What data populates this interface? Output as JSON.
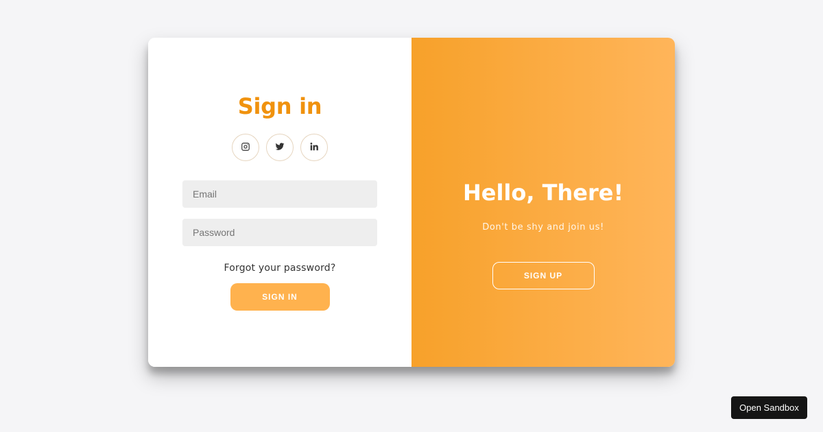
{
  "signin": {
    "title": "Sign in",
    "socials": [
      {
        "icon": "instagram-icon"
      },
      {
        "icon": "twitter-icon"
      },
      {
        "icon": "linkedin-icon"
      }
    ],
    "email_placeholder": "Email",
    "email_value": "",
    "password_placeholder": "Password",
    "password_value": "",
    "forgot_label": "Forgot your password?",
    "button_label": "SIGN IN"
  },
  "overlay": {
    "title": "Hello, There!",
    "subtitle": "Don't be shy and join us!",
    "button_label": "SIGN UP"
  },
  "sandbox": {
    "label": "Open Sandbox"
  },
  "colors": {
    "accent": "#f0920e",
    "button": "#ffb24e",
    "gradient_start": "#f7a12a",
    "gradient_end": "#ffb55a",
    "background": "#f5f5f7"
  }
}
